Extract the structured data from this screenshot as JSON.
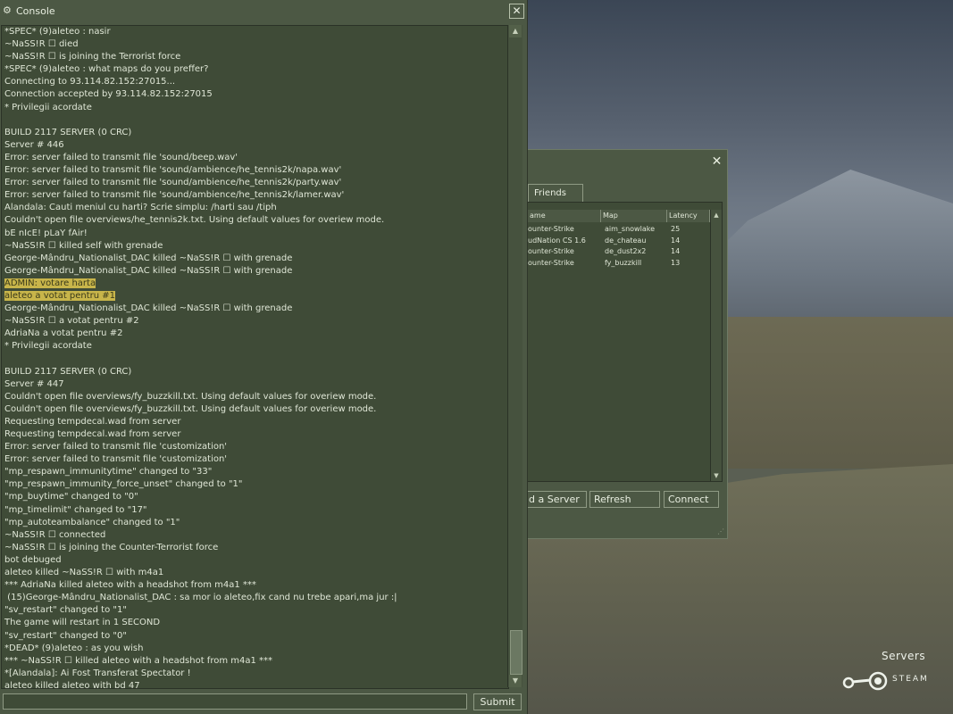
{
  "console": {
    "title": "Console",
    "close_label": "✕",
    "submit_label": "Submit",
    "input_value": "",
    "log": [
      {
        "text": "*SPEC* (9)aleteo : nasir"
      },
      {
        "text": "~NaSS!R ☐ died"
      },
      {
        "text": "~NaSS!R ☐ is joining the Terrorist force"
      },
      {
        "text": "*SPEC* (9)aleteo : what maps do you preffer?"
      },
      {
        "text": "Connecting to 93.114.82.152:27015..."
      },
      {
        "text": "Connection accepted by 93.114.82.152:27015"
      },
      {
        "text": "* Privilegii acordate"
      },
      {
        "text": ""
      },
      {
        "text": "BUILD 2117 SERVER (0 CRC)"
      },
      {
        "text": "Server # 446"
      },
      {
        "text": "Error: server failed to transmit file 'sound/beep.wav'"
      },
      {
        "text": "Error: server failed to transmit file 'sound/ambience/he_tennis2k/napa.wav'"
      },
      {
        "text": "Error: server failed to transmit file 'sound/ambience/he_tennis2k/party.wav'"
      },
      {
        "text": "Error: server failed to transmit file 'sound/ambience/he_tennis2k/lamer.wav'"
      },
      {
        "text": "Alandala: Cauti meniul cu harti? Scrie simplu: /harti sau /tiph"
      },
      {
        "text": "Couldn't open file overviews/he_tennis2k.txt. Using default values for overiew mode."
      },
      {
        "text": "bE nIcE! pLaY fAir!"
      },
      {
        "text": "~NaSS!R ☐ killed self with grenade"
      },
      {
        "text": "George-Mândru_Nationalist_DAC killed ~NaSS!R ☐ with grenade"
      },
      {
        "text": "George-Mândru_Nationalist_DAC killed ~NaSS!R ☐ with grenade"
      },
      {
        "text": "ADMIN: votare harta",
        "highlight": true
      },
      {
        "text": "aleteo a votat pentru #1",
        "highlight": true
      },
      {
        "text": "George-Mândru_Nationalist_DAC killed ~NaSS!R ☐ with grenade"
      },
      {
        "text": "~NaSS!R ☐ a votat pentru #2"
      },
      {
        "text": "AdriaNa a votat pentru #2"
      },
      {
        "text": "* Privilegii acordate"
      },
      {
        "text": ""
      },
      {
        "text": "BUILD 2117 SERVER (0 CRC)"
      },
      {
        "text": "Server # 447"
      },
      {
        "text": "Couldn't open file overviews/fy_buzzkill.txt. Using default values for overiew mode."
      },
      {
        "text": "Couldn't open file overviews/fy_buzzkill.txt. Using default values for overiew mode."
      },
      {
        "text": "Requesting tempdecal.wad from server"
      },
      {
        "text": "Requesting tempdecal.wad from server"
      },
      {
        "text": "Error: server failed to transmit file 'customization'"
      },
      {
        "text": "Error: server failed to transmit file 'customization'"
      },
      {
        "text": "\"mp_respawn_immunitytime\" changed to \"33\""
      },
      {
        "text": "\"mp_respawn_immunity_force_unset\" changed to \"1\""
      },
      {
        "text": "\"mp_buytime\" changed to \"0\""
      },
      {
        "text": "\"mp_timelimit\" changed to \"17\""
      },
      {
        "text": "\"mp_autoteambalance\" changed to \"1\""
      },
      {
        "text": "~NaSS!R ☐ connected"
      },
      {
        "text": "~NaSS!R ☐ is joining the Counter-Terrorist force"
      },
      {
        "text": "bot debuged"
      },
      {
        "text": "aleteo killed ~NaSS!R ☐ with m4a1"
      },
      {
        "text": "*** AdriaNa killed aleteo with a headshot from m4a1 ***"
      },
      {
        "text": " (15)George-Mândru_Nationalist_DAC : sa mor io aleteo,fix cand nu trebe apari,ma jur :|"
      },
      {
        "text": "\"sv_restart\" changed to \"1\""
      },
      {
        "text": "The game will restart in 1 SECOND"
      },
      {
        "text": "\"sv_restart\" changed to \"0\""
      },
      {
        "text": "*DEAD* (9)aleteo : as you wish"
      },
      {
        "text": "*** ~NaSS!R ☐ killed aleteo with a headshot from m4a1 ***"
      },
      {
        "text": "*[Alandala]: Ai Fost Transferat Spectator !"
      },
      {
        "text": "aleteo killed aleteo with bd 47"
      }
    ]
  },
  "servers": {
    "close_label": "✕",
    "tab_friends": "Friends",
    "columns": {
      "name": "ame",
      "map": "Map",
      "latency": "Latency"
    },
    "rows": [
      {
        "name": "ounter-Strike",
        "map": "aim_snowlake",
        "latency": "25"
      },
      {
        "name": "udNation CS 1.6",
        "map": "de_chateau",
        "latency": "14"
      },
      {
        "name": "ounter-Strike",
        "map": "de_dust2x2",
        "latency": "14"
      },
      {
        "name": "ounter-Strike",
        "map": "fy_buzzkill",
        "latency": "13"
      }
    ],
    "buttons": {
      "add": "d a Server",
      "refresh": "Refresh",
      "connect": "Connect"
    }
  },
  "badge": {
    "title": "Servers",
    "steam": "STEAM"
  },
  "colors": {
    "panel": "#4c5844",
    "log_bg": "#3f4b37",
    "highlight": "#c8b54a",
    "text": "#dfe6d6"
  }
}
